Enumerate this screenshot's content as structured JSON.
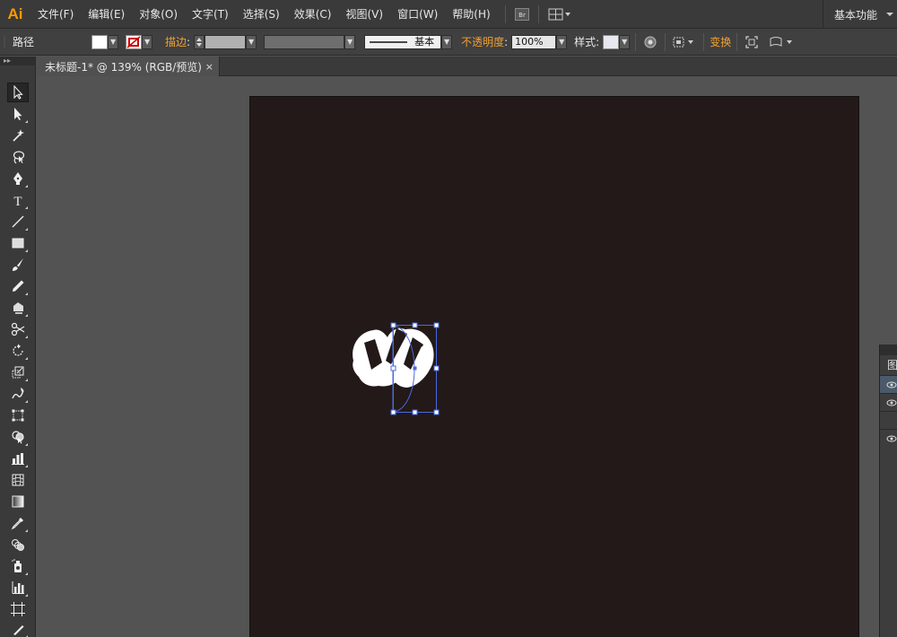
{
  "app": {
    "logo": "Ai"
  },
  "menu": [
    "文件(F)",
    "编辑(E)",
    "对象(O)",
    "文字(T)",
    "选择(S)",
    "效果(C)",
    "视图(V)",
    "窗口(W)",
    "帮助(H)"
  ],
  "menubar_icons": {
    "bridge_label": "Br"
  },
  "workspace": {
    "label": "基本功能"
  },
  "control": {
    "object_type": "路径",
    "stroke_label": "描边",
    "stroke_profile": "基本",
    "opacity_label": "不透明度",
    "opacity_value": "100%",
    "style_label": "样式",
    "transform_label": "变换",
    "fill_color": "#ffffff",
    "accent_color": "#f0a030"
  },
  "document": {
    "tab_title": "未标题-1* @ 139% (RGB/预览)",
    "close_glyph": "×"
  },
  "tools": [
    {
      "name": "selection-tool-icon",
      "active": true
    },
    {
      "name": "direct-selection-tool-icon"
    },
    {
      "name": "magic-wand-tool-icon"
    },
    {
      "name": "lasso-tool-icon"
    },
    {
      "name": "pen-tool-icon"
    },
    {
      "name": "type-tool-icon",
      "glyph": "T"
    },
    {
      "name": "line-segment-tool-icon"
    },
    {
      "name": "rectangle-tool-icon"
    },
    {
      "name": "paintbrush-tool-icon"
    },
    {
      "name": "pencil-tool-icon"
    },
    {
      "name": "blob-brush-tool-icon"
    },
    {
      "name": "scissors-tool-icon"
    },
    {
      "name": "rotate-tool-icon"
    },
    {
      "name": "scale-tool-icon"
    },
    {
      "name": "warp-tool-icon"
    },
    {
      "name": "free-transform-tool-icon"
    },
    {
      "name": "shape-builder-tool-icon"
    },
    {
      "name": "graph-tool-icon"
    },
    {
      "name": "mesh-tool-icon"
    },
    {
      "name": "gradient-tool-icon"
    },
    {
      "name": "eyedropper-tool-icon"
    },
    {
      "name": "blend-tool-icon"
    },
    {
      "name": "symbol-sprayer-tool-icon"
    },
    {
      "name": "column-graph-tool-icon"
    },
    {
      "name": "artboard-tool-icon"
    },
    {
      "name": "slice-tool-icon"
    }
  ],
  "layers_panel": {
    "title_fragment": "图"
  }
}
